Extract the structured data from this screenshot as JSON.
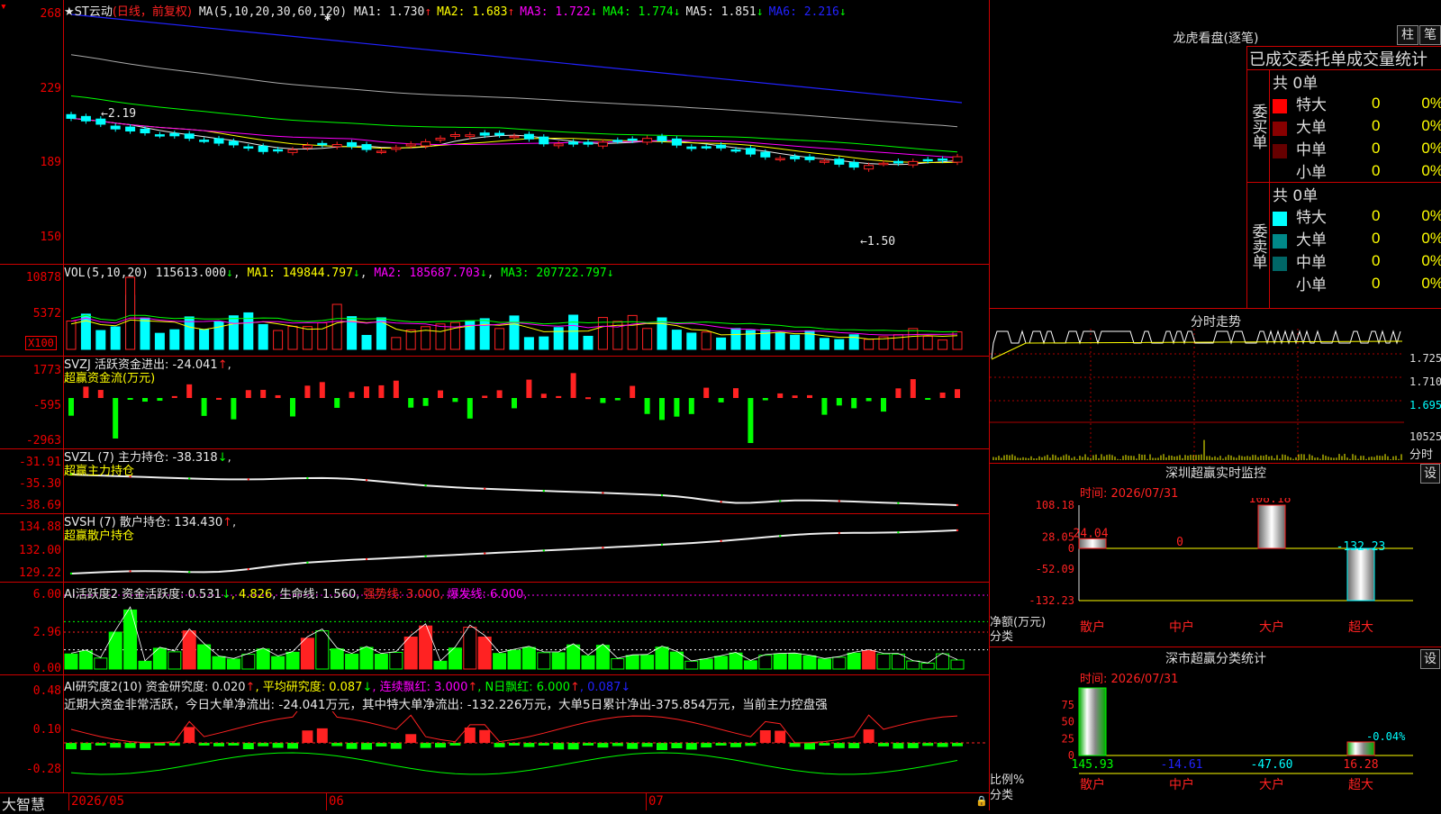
{
  "main": {
    "title": "★ST云动",
    "period": "(日线，前复权)",
    "ma_label": "MA(5,10,20,30,60,120)",
    "ma": [
      {
        "label": "MA1:",
        "value": "1.730",
        "arrow": "↑",
        "color": "#e8e8e8",
        "arrow_color": "#f22"
      },
      {
        "label": "MA2:",
        "value": "1.683",
        "arrow": "↑",
        "color": "#ff0",
        "arrow_color": "#f22"
      },
      {
        "label": "MA3:",
        "value": "1.722",
        "arrow": "↓",
        "color": "#f0f",
        "arrow_color": "#0f0"
      },
      {
        "label": "MA4:",
        "value": "1.774",
        "arrow": "↓",
        "color": "#0f0",
        "arrow_color": "#0f0"
      },
      {
        "label": "MA5:",
        "value": "1.851",
        "arrow": "↓",
        "color": "#e8e8e8",
        "arrow_color": "#0f0"
      },
      {
        "label": "MA6:",
        "value": "2.216",
        "arrow": "↓",
        "color": "#22f",
        "arrow_color": "#0f0"
      }
    ],
    "y_ticks": [
      "268",
      "229",
      "189",
      "150"
    ],
    "annot_high": "2.19",
    "annot_low": "1.50"
  },
  "vol": {
    "label": "VOL(5,10,20)",
    "value": "115613.000",
    "arrow": "↓",
    "ma1": "MA1: 149844.797",
    "ma2": "MA2: 185687.703",
    "ma3": "MA3: 207722.797",
    "y_ticks": [
      "10878",
      "5372"
    ],
    "unit": "X100"
  },
  "svzj": {
    "title": "SVZJ  活跃资金进出: -24.041",
    "arrow": "↑",
    "sub": "超赢资金流(万元)",
    "y_ticks": [
      "1773",
      "-595",
      "-2963"
    ]
  },
  "svzl": {
    "title": "SVZL (7) 主力持仓: -38.318",
    "arrow": "↓",
    "sub": "超赢主力持仓",
    "y_ticks": [
      "-31.91",
      "-35.30",
      "-38.69"
    ]
  },
  "svsh": {
    "title": "SVSH (7) 散户持仓: 134.430",
    "arrow": "↑",
    "sub": "超赢散户持仓",
    "y_ticks": [
      "134.88",
      "132.00",
      "129.22"
    ]
  },
  "ai1": {
    "title": "AI活跃度2 资金活跃度: 0.531",
    "a1": "↓",
    "v2": ", 4.826",
    "life": ", 生命线: 1.560,",
    "strong": " 强势线: 3.000,",
    "burst": " 爆发线: 6.000,",
    "y_ticks": [
      "6.00",
      "2.96",
      "0.00"
    ]
  },
  "ai2": {
    "title": "AI研究度2(10) 资金研究度: 0.020",
    "a1": "↑",
    "avg": ", 平均研究度: 0.087",
    "a2": "↓",
    "red": ", 连续飘红: 3.000",
    "a3": "↑",
    "nred": ", N日飘红: 6.000",
    "a4": "↑",
    "last": ", 0.087",
    "a5": "↓",
    "comment": "近期大资金非常活跃，今日大单净流出: -24.041万元，其中特大单净流出: -132.226万元，大单5日累计净出-375.854万元，当前主力控盘强",
    "y_ticks": [
      "0.48",
      "0.10",
      "-0.28"
    ]
  },
  "xaxis": {
    "brand": "大智慧",
    "labels": [
      "2026/05",
      "06",
      "07"
    ]
  },
  "lhb": {
    "title": "龙虎看盘(逐笔)",
    "btn1": "柱",
    "btn2": "笔",
    "subtitle": "已成交委托单成交量统计",
    "buy": {
      "side": "委买单",
      "total": "共 0单",
      "rows": [
        {
          "name": "特大",
          "count": "0",
          "pct": "0%",
          "color": "#f00"
        },
        {
          "name": "大单",
          "count": "0",
          "pct": "0%",
          "color": "#800"
        },
        {
          "name": "中单",
          "count": "0",
          "pct": "0%",
          "color": "#600"
        },
        {
          "name": "小单",
          "count": "0",
          "pct": "0%",
          "color": ""
        }
      ]
    },
    "sell": {
      "side": "委卖单",
      "total": "共 0单",
      "rows": [
        {
          "name": "特大",
          "count": "0",
          "pct": "0%",
          "color": "#0ff"
        },
        {
          "name": "大单",
          "count": "0",
          "pct": "0%",
          "color": "#088"
        },
        {
          "name": "中单",
          "count": "0",
          "pct": "0%",
          "color": "#066"
        },
        {
          "name": "小单",
          "count": "0",
          "pct": "0%",
          "color": ""
        }
      ]
    }
  },
  "fs": {
    "title": "分时走势",
    "y": [
      "1.725",
      "1.710",
      "1.695"
    ],
    "vol_top": "10525",
    "unit": "分时"
  },
  "mon": {
    "title": "深圳超赢实时监控",
    "btn": "设",
    "time": "时间: 2026/07/31",
    "y": [
      "108.18",
      "28.05",
      "0",
      "-52.09",
      "-132.23"
    ],
    "ylabel": "净额(万元)",
    "xlabel": "分类",
    "cats": [
      "散户",
      "中户",
      "大户",
      "超大"
    ],
    "values": [
      24.04,
      0,
      108.18,
      -132.23
    ],
    "val_labels": [
      "24.04",
      "0",
      "108.18",
      "-132.23"
    ]
  },
  "cls": {
    "title": "深市超赢分类统计",
    "btn": "设",
    "time": "时间: 2026/07/31",
    "y": [
      "75",
      "50",
      "25",
      "0"
    ],
    "ylabel": "比例%",
    "xlabel": "分类",
    "cats": [
      "散户",
      "中户",
      "大户",
      "超大"
    ],
    "bottom": [
      "145.93",
      "-14.61",
      "-47.60",
      "16.28"
    ],
    "bottom_colors": [
      "#0f0",
      "#22f",
      "#0ff",
      "#f22"
    ],
    "bars": [
      100,
      0,
      0,
      20
    ],
    "super_pct": "-0.04%"
  },
  "chart_data": {
    "type": "candlestick",
    "title": "★ST云动 (日线，前复权)",
    "y_ticks": [
      "268",
      "229",
      "189",
      "150"
    ],
    "annotations": [
      "2.19",
      "1.50"
    ],
    "x_labels": [
      "2026/05",
      "06",
      "07"
    ]
  }
}
